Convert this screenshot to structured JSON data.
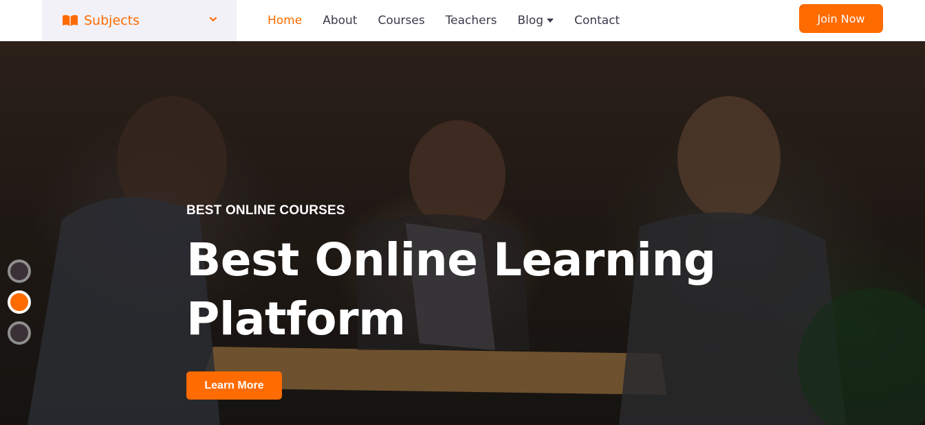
{
  "colors": {
    "accent": "#fe6b01",
    "nav_text": "#3a3a4a",
    "subjects_bg": "#f2f1f8"
  },
  "nav": {
    "subjects": {
      "label": "Subjects",
      "icon": "book-icon",
      "chevron": "chevron-down-icon"
    },
    "items": [
      {
        "label": "Home",
        "active": true
      },
      {
        "label": "About",
        "active": false
      },
      {
        "label": "Courses",
        "active": false
      },
      {
        "label": "Teachers",
        "active": false
      },
      {
        "label": "Blog",
        "active": false,
        "dropdown": true
      },
      {
        "label": "Contact",
        "active": false
      }
    ],
    "join_label": "Join Now"
  },
  "hero": {
    "kicker": "BEST ONLINE COURSES",
    "headline": "Best Online Learning Platform",
    "button_label": "Learn More",
    "slides": {
      "count": 3,
      "active_index": 1
    }
  }
}
